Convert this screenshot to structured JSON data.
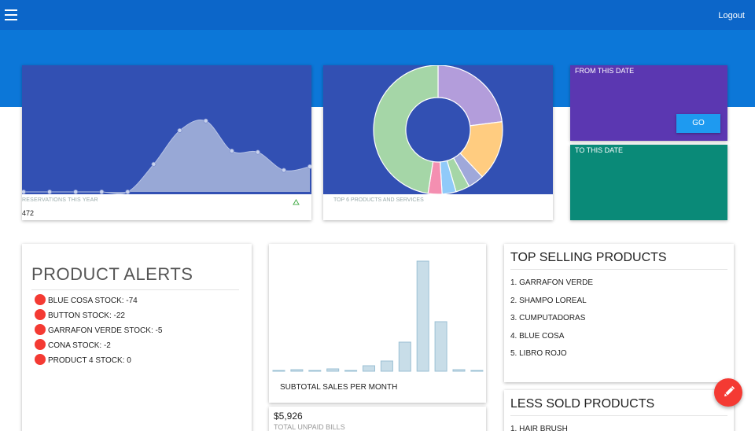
{
  "header": {
    "logout_label": "Logout"
  },
  "reservations": {
    "label": "RESERVATIONS THIS YEAR",
    "value": "472",
    "chart_data": {
      "type": "area",
      "values": [
        0,
        0,
        0,
        0,
        0,
        0.23,
        0.51,
        0.59,
        0.34,
        0.33,
        0.18,
        0.21
      ]
    }
  },
  "products_chart": {
    "label": "TOP 6 PRODUCTS AND SERVICES",
    "chart_data": {
      "type": "pie",
      "slices": [
        {
          "value": 23,
          "color": "#b39ddb"
        },
        {
          "value": 15,
          "color": "#ffcc80"
        },
        {
          "value": 4,
          "color": "#9fa8da"
        },
        {
          "value": 3.5,
          "color": "#a5d6a7"
        },
        {
          "value": 3.5,
          "color": "#90caf9"
        },
        {
          "value": 3.5,
          "color": "#f48fb1"
        },
        {
          "value": 47.5,
          "color": "#a5d6a7"
        }
      ]
    }
  },
  "date_filter": {
    "from_label": "FROM THIS DATE",
    "go_label": "GO",
    "to_label": "TO THIS DATE"
  },
  "alerts": {
    "title": "PRODUCT ALERTS",
    "items": [
      "BLUE COSA STOCK: -74",
      "BUTTON STOCK: -22",
      "GARRAFON VERDE STOCK: -5",
      "CONA STOCK: -2",
      "PRODUCT 4 STOCK: 0"
    ]
  },
  "sales": {
    "label": "SUBTOTAL SALES PER MONTH",
    "chart_data": {
      "type": "bar",
      "values": [
        1,
        2,
        1,
        3,
        1,
        7,
        13,
        37,
        140,
        63,
        2,
        1
      ]
    }
  },
  "unpaid": {
    "value": "$5,926",
    "label": "TOTAL UNPAID BILLS"
  },
  "top_selling": {
    "title": "TOP SELLING PRODUCTS",
    "items": [
      "1. GARRAFON VERDE",
      "2. SHAMPO LOREAL",
      "3. CUMPUTADORAS",
      "4. BLUE COSA",
      "5. LIBRO ROJO"
    ]
  },
  "less_sold": {
    "title": "LESS SOLD PRODUCTS",
    "items": [
      "1. HAIR BRUSH"
    ]
  },
  "colors": {
    "topbar": "#0c66c9",
    "hero": "#0c77d8",
    "chart_bg": "#3250b3",
    "from_card": "#5b37b1",
    "to_card": "#0a8a78",
    "accent_red": "#f43a33",
    "go_button": "#1e9af0"
  },
  "icons": {
    "menu": "hamburger-menu-icon",
    "fab": "pencil-icon",
    "trend": "triangle-up-icon"
  }
}
